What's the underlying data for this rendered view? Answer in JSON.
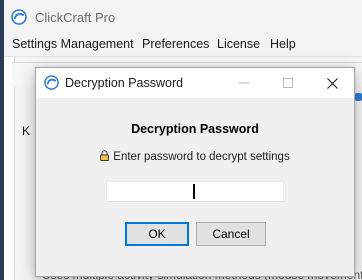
{
  "app": {
    "title": "ClickCraft Pro",
    "menu": [
      "Settings Management",
      "Preferences",
      "License",
      "Help"
    ],
    "tab_label": "K",
    "background_text": "Uses multiple activity simulation methods (mouse movement"
  },
  "dialog": {
    "title": "Decryption Password",
    "heading": "Decryption Password",
    "prompt": "Enter password to decrypt settings",
    "password_value": "",
    "ok_label": "OK",
    "cancel_label": "Cancel"
  },
  "colors": {
    "accent": "#0078d7",
    "logo_blue": "#2f7bd6"
  },
  "icons": {
    "app_logo": "app-logo-icon",
    "dialog_logo": "dialog-logo-icon",
    "lock": "lock-icon",
    "minimize": "minimize-icon",
    "maximize": "maximize-icon",
    "close": "close-icon"
  }
}
